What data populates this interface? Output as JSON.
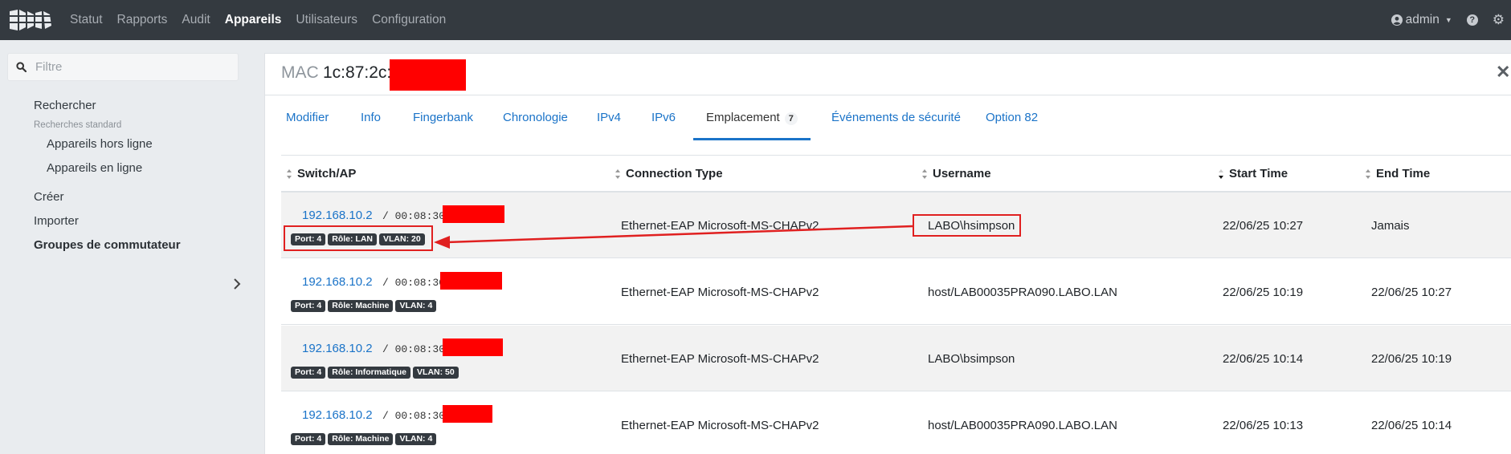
{
  "navbar": {
    "logo_icon": "logo-icon",
    "links": [
      "Statut",
      "Rapports",
      "Audit",
      "Appareils",
      "Utilisateurs",
      "Configuration"
    ],
    "active": "Appareils",
    "user": "admin"
  },
  "sidebar": {
    "filter_placeholder": "Filtre",
    "search": "Rechercher",
    "saved_searches_label": "Recherches standard",
    "offline": "Appareils hors ligne",
    "online": "Appareils en ligne",
    "create": "Créer",
    "import": "Importer",
    "switch_groups": "Groupes de commutateur"
  },
  "panel": {
    "mac_label": "MAC",
    "mac_value": "1c:87:2c:",
    "tabs": [
      {
        "label": "Modifier"
      },
      {
        "label": "Info"
      },
      {
        "label": "Fingerbank"
      },
      {
        "label": "Chronologie"
      },
      {
        "label": "IPv4"
      },
      {
        "label": "IPv6"
      },
      {
        "label": "Emplacement",
        "count": "7"
      },
      {
        "label": "Événements de sécurité"
      },
      {
        "label": "Option 82"
      }
    ],
    "active_tab": "Emplacement"
  },
  "table": {
    "columns": [
      "Switch/AP",
      "Connection Type",
      "Username",
      "Start Time",
      "End Time"
    ],
    "sorted_column": "Start Time",
    "rows": [
      {
        "ip": "192.168.10.2",
        "mac": "/ 00:08:30:",
        "port": "Port: 4",
        "role": "Rôle: LAN",
        "vlan": "VLAN: 20",
        "connection": "Ethernet-EAP Microsoft-MS-CHAPv2",
        "username": "LABO\\hsimpson",
        "start": "22/06/25 10:27",
        "end": "Jamais"
      },
      {
        "ip": "192.168.10.2",
        "mac": "/ 00:08:30",
        "port": "Port: 4",
        "role": "Rôle: Machine",
        "vlan": "VLAN: 4",
        "connection": "Ethernet-EAP Microsoft-MS-CHAPv2",
        "username": "host/LAB00035PRA090.LABO.LAN",
        "start": "22/06/25 10:19",
        "end": "22/06/25 10:27"
      },
      {
        "ip": "192.168.10.2",
        "mac": "/ 00:08:30:",
        "port": "Port: 4",
        "role": "Rôle: Informatique",
        "vlan": "VLAN: 50",
        "connection": "Ethernet-EAP Microsoft-MS-CHAPv2",
        "username": "LABO\\bsimpson",
        "start": "22/06/25 10:14",
        "end": "22/06/25 10:19"
      },
      {
        "ip": "192.168.10.2",
        "mac": "/ 00:08:30:",
        "port": "Port: 4",
        "role": "Rôle: Machine",
        "vlan": "VLAN: 4",
        "connection": "Ethernet-EAP Microsoft-MS-CHAPv2",
        "username": "host/LAB00035PRA090.LABO.LAN",
        "start": "22/06/25 10:13",
        "end": "22/06/25 10:14"
      }
    ]
  },
  "colors": {
    "navbar": "#343a40",
    "link": "#1a73c8",
    "annotation": "#e02020",
    "redaction": "#ff0000"
  }
}
